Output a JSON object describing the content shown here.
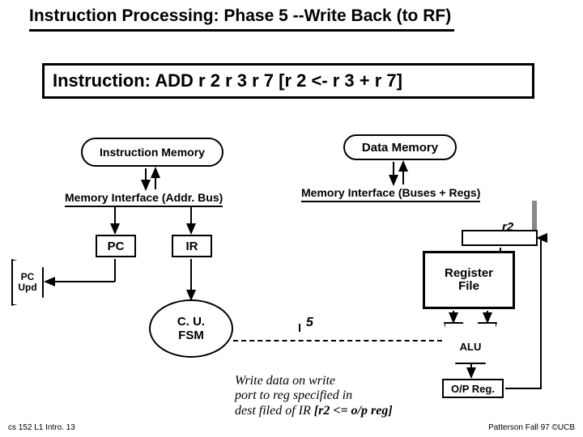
{
  "title": "Instruction Processing: Phase 5 --Write Back (to RF)",
  "instruction": "Instruction: ADD r 2 r 3 r 7  [r 2 <- r 3 + r 7]",
  "blocks": {
    "instr_mem": "Instruction Memory",
    "data_mem": "Data Memory",
    "mem_if_left": "Memory Interface (Addr. Bus)",
    "mem_if_right": "Memory Interface (Buses + Regs)",
    "pc": "PC",
    "ir": "IR",
    "r2": "r2",
    "reg_file": "Register\nFile",
    "cu_line1": "C. U.",
    "cu_line2": "FSM",
    "alu": "ALU",
    "op_reg": "O/P Reg.",
    "mux_line1": "PC",
    "mux_line2": "Upd"
  },
  "annotations": {
    "five": "5",
    "note_line1": "Write data on write",
    "note_line2": "port to reg specified in",
    "note_line3a": "dest filed of IR ",
    "note_line3b": "[r2 <= o/p reg]"
  },
  "footer": {
    "left": "cs 152  L1 Intro. 13",
    "right": "Patterson Fall 97  ©UCB"
  }
}
